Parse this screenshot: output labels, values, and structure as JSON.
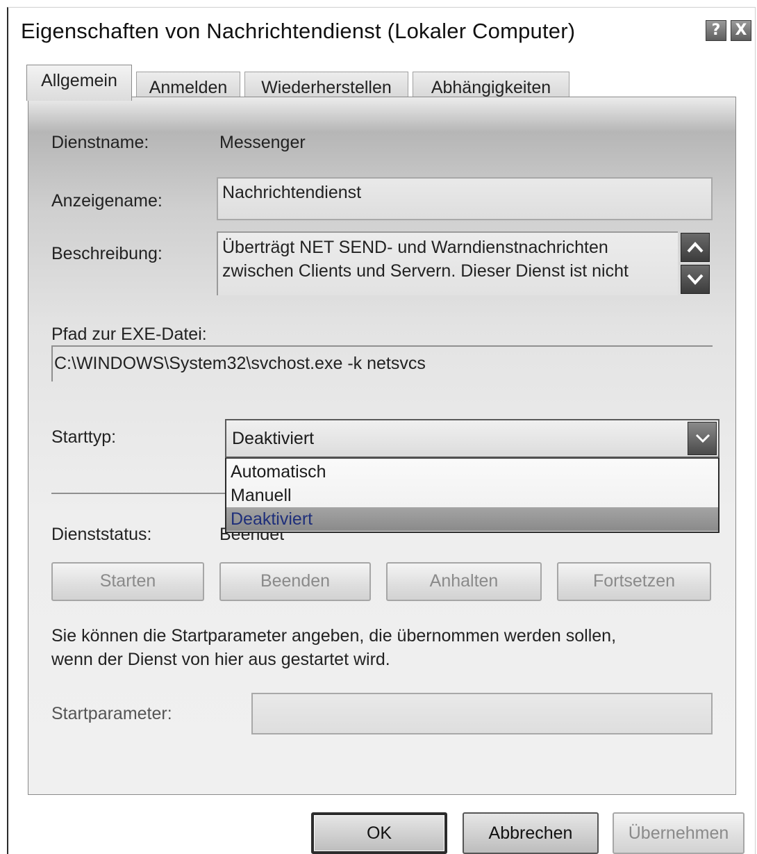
{
  "window": {
    "title": "Eigenschaften von Nachrichtendienst (Lokaler Computer)",
    "help_button": "?",
    "close_button": "X"
  },
  "tabs": [
    {
      "label": "Allgemein",
      "active": true
    },
    {
      "label": "Anmelden",
      "active": false
    },
    {
      "label": "Wiederherstellen",
      "active": false
    },
    {
      "label": "Abhängigkeiten",
      "active": false
    }
  ],
  "general": {
    "service_name_label": "Dienstname:",
    "service_name_value": "Messenger",
    "display_name_label": "Anzeigename:",
    "display_name_value": "Nachrichtendienst",
    "description_label": "Beschreibung:",
    "description_line1": "Überträgt NET SEND- und Warndienstnachrichten",
    "description_line2": "zwischen Clients und Servern. Dieser Dienst ist nicht",
    "exe_path_label": "Pfad zur EXE-Datei:",
    "exe_path_value": "C:\\WINDOWS\\System32\\svchost.exe -k netsvcs",
    "startup_type_label": "Starttyp:",
    "startup_type_value": "Deaktiviert",
    "startup_type_options": [
      "Automatisch",
      "Manuell",
      "Deaktiviert"
    ],
    "service_status_label": "Dienststatus:",
    "service_status_value": "Beendet",
    "buttons": {
      "start": "Starten",
      "stop": "Beenden",
      "pause": "Anhalten",
      "resume": "Fortsetzen"
    },
    "hint_line1": "Sie können die Startparameter angeben, die übernommen werden sollen,",
    "hint_line2": "wenn der Dienst von hier aus gestartet wird.",
    "start_params_label": "Startparameter:",
    "start_params_value": ""
  },
  "footer": {
    "ok": "OK",
    "cancel": "Abbrechen",
    "apply": "Übernehmen"
  },
  "colors": {
    "selected_option_text": "#1f2f7a",
    "disabled_text": "#8a8a8a"
  }
}
